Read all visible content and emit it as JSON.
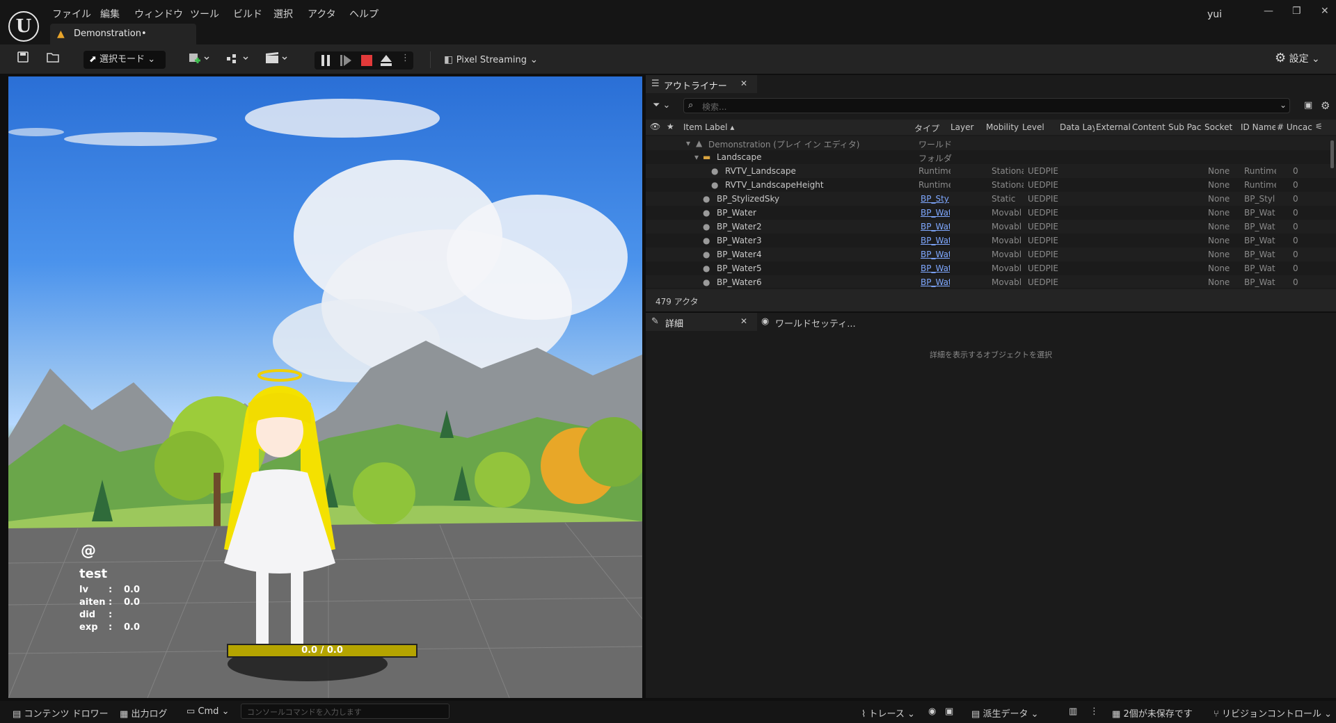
{
  "app": {
    "logo_glyph": "U",
    "user": "yui"
  },
  "menu": [
    "ファイル",
    "編集",
    "ウィンドウ",
    "ツール",
    "ビルド",
    "選択",
    "アクタ",
    "ヘルプ"
  ],
  "document_tab": {
    "label": "Demonstration•"
  },
  "window_controls": {
    "minimize": "—",
    "restore": "❐",
    "close": "✕"
  },
  "toolbar": {
    "mode_label": "選択モード",
    "pixel_streaming_label": "Pixel Streaming",
    "settings_label": "設定"
  },
  "viewport": {
    "hud": {
      "symbol": "@",
      "name": "test",
      "stats": [
        {
          "label": "lv",
          "sep": ":",
          "value": "0.0"
        },
        {
          "label": "aiten",
          "sep": ":",
          "value": "0.0"
        },
        {
          "label": "did",
          "sep": ":",
          "value": ""
        },
        {
          "label": "exp",
          "sep": ":",
          "value": "0.0"
        }
      ],
      "bar_text": "0.0 / 0.0"
    }
  },
  "outliner": {
    "tab_label": "アウトライナー",
    "search_placeholder": "検索...",
    "columns": [
      "Item Label ▴",
      "タイプ",
      "Layer",
      "Mobility",
      "Level",
      "Data Lay",
      "External",
      "Content",
      "Sub Pac",
      "Socket",
      "ID Name",
      "# Uncac"
    ],
    "rows": [
      {
        "label": "Demonstration (プレイ イン エディタ)",
        "type": "ワールド",
        "mobility": "",
        "level": "",
        "socket": "",
        "idname": "",
        "uncac": "",
        "link": false
      },
      {
        "label": "Landscape",
        "type": "フォルダ",
        "mobility": "",
        "level": "",
        "socket": "",
        "idname": "",
        "uncac": "",
        "link": false
      },
      {
        "label": "RVTV_Landscape",
        "type": "Runtime",
        "mobility": "Stationa",
        "level": "UEDPIE",
        "socket": "None",
        "idname": "Runtime",
        "uncac": "0",
        "link": false
      },
      {
        "label": "RVTV_LandscapeHeight",
        "type": "Runtime",
        "mobility": "Stationa",
        "level": "UEDPIE",
        "socket": "None",
        "idname": "Runtime",
        "uncac": "0",
        "link": false
      },
      {
        "label": "BP_StylizedSky",
        "type": "BP_Sty",
        "mobility": "Static",
        "level": "UEDPIE",
        "socket": "None",
        "idname": "BP_Styl",
        "uncac": "0",
        "link": true
      },
      {
        "label": "BP_Water",
        "type": "BP_Wat",
        "mobility": "Movabl",
        "level": "UEDPIE",
        "socket": "None",
        "idname": "BP_Wat",
        "uncac": "0",
        "link": true
      },
      {
        "label": "BP_Water2",
        "type": "BP_Wat",
        "mobility": "Movabl",
        "level": "UEDPIE",
        "socket": "None",
        "idname": "BP_Wat",
        "uncac": "0",
        "link": true
      },
      {
        "label": "BP_Water3",
        "type": "BP_Wat",
        "mobility": "Movabl",
        "level": "UEDPIE",
        "socket": "None",
        "idname": "BP_Wat",
        "uncac": "0",
        "link": true
      },
      {
        "label": "BP_Water4",
        "type": "BP_Wat",
        "mobility": "Movabl",
        "level": "UEDPIE",
        "socket": "None",
        "idname": "BP_Wat",
        "uncac": "0",
        "link": true
      },
      {
        "label": "BP_Water5",
        "type": "BP_Wat",
        "mobility": "Movabl",
        "level": "UEDPIE",
        "socket": "None",
        "idname": "BP_Wat",
        "uncac": "0",
        "link": true
      },
      {
        "label": "BP_Water6",
        "type": "BP_Wat",
        "mobility": "Movabl",
        "level": "UEDPIE",
        "socket": "None",
        "idname": "BP_Wat",
        "uncac": "0",
        "link": true
      }
    ],
    "actor_count": "479 アクタ"
  },
  "details": {
    "tab_label": "詳細",
    "world_settings_tab": "ワールドセッティ...",
    "empty_message": "詳細を表示するオブジェクトを選択"
  },
  "statusbar": {
    "content_drawer": "コンテンツ ドロワー",
    "output_log": "出力ログ",
    "cmd": "Cmd",
    "console_placeholder": "コンソールコマンドを入力します",
    "trace": "トレース",
    "derived_data": "派生データ",
    "unsaved": "2個が未保存です",
    "revision_control": "リビジョンコントロール"
  },
  "colors": {
    "accent_orange": "#e8a42a",
    "link": "#7fa8ff",
    "hud_bar": "#b5a400",
    "stop_red": "#e23a3a"
  }
}
